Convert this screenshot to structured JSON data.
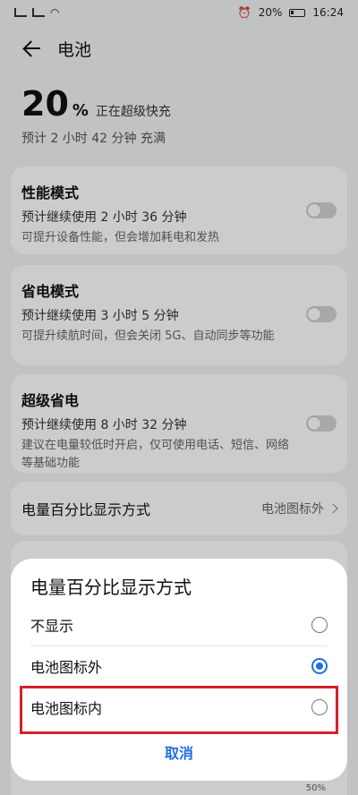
{
  "status_bar": {
    "time": "16:24",
    "battery_pct": "20%"
  },
  "header": {
    "title": "电池"
  },
  "summary": {
    "percent": "20",
    "percent_sign": "%",
    "status": "正在超级快充",
    "estimate": "预计 2 小时 42 分钟 充满"
  },
  "modes": [
    {
      "title": "性能模式",
      "use": "预计继续使用 2 小时 36 分钟",
      "desc": "可提升设备性能，但会增加耗电和发热",
      "enabled": false
    },
    {
      "title": "省电模式",
      "use": "预计继续使用 3 小时 5 分钟",
      "desc": "可提升续航时间，但会关闭 5G、自动同步等功能",
      "enabled": false
    },
    {
      "title": "超级省电",
      "use": "预计继续使用 8 小时 32 分钟",
      "desc": "建议在电量较低时开启，仅可使用电话、短信、网络等基础功能",
      "enabled": false
    }
  ],
  "percent_display": {
    "label": "电量百分比显示方式",
    "value": "电池图标外"
  },
  "background_chart": {
    "axis_label": "50%"
  },
  "dialog": {
    "title": "电量百分比显示方式",
    "options": [
      {
        "label": "不显示",
        "selected": false
      },
      {
        "label": "电池图标外",
        "selected": true
      },
      {
        "label": "电池图标内",
        "selected": false
      }
    ],
    "cancel_label": "取消"
  },
  "colors": {
    "accent": "#1f6fe5",
    "highlight": "#d6202a"
  }
}
